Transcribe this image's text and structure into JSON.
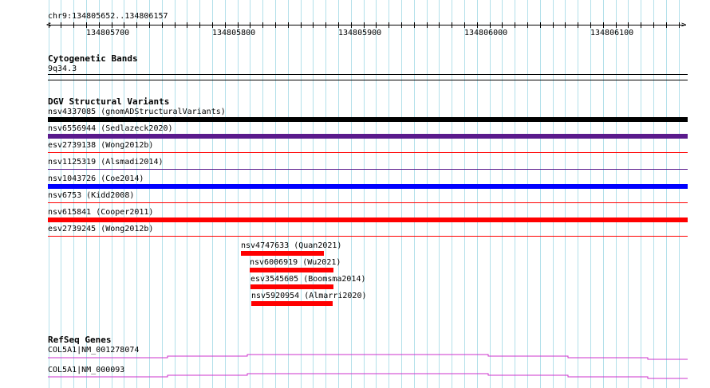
{
  "location": "chr9:134805652..134806157",
  "ruler": {
    "labels": [
      "134805700",
      "134805800",
      "134805900",
      "134806000",
      "134806100"
    ]
  },
  "tracks": {
    "cyto": {
      "title": "Cytogenetic Bands",
      "band": "9q34.3",
      "color": "#000000"
    },
    "dgv": {
      "title": "DGV Structural Variants",
      "items": [
        {
          "label": "nsv4337085 (gnomADStructuralVariants)",
          "color": "#000000"
        },
        {
          "label": "nsv6556944 (Sedlazeck2020)",
          "color": "#5a1a8c"
        },
        {
          "label": "esv2739138 (Wong2012b)",
          "color": "#ff0000"
        },
        {
          "label": "nsv1125319 (Alsmadi2014)",
          "color": "#ff0000"
        },
        {
          "label": "nsv1043726 (Coe2014)",
          "color": "#5a1a8c"
        },
        {
          "label": "nsv6753 (Kidd2008)",
          "color": "#0000ff"
        },
        {
          "label": "nsv615841 (Cooper2011)",
          "color": "#ff0000"
        },
        {
          "label": "esv2739245 (Wong2012b)",
          "color": "#ff0000"
        },
        {
          "label": "nsv4747633 (Quan2021)",
          "color": "#ff0000"
        },
        {
          "label": "nsv6006919 (Wu2021)",
          "color": "#ff0000"
        },
        {
          "label": "esv3545605 (Boomsma2014)",
          "color": "#ff0000"
        },
        {
          "label": "nsv5920954 (Almarri2020)",
          "color": "#ff0000"
        }
      ]
    },
    "refseq": {
      "title": "RefSeq Genes",
      "genes": [
        {
          "label": "COL5A1|NM_001278074",
          "color": "#cc33cc"
        },
        {
          "label": "COL5A1|NM_000093",
          "color": "#cc33cc"
        }
      ]
    }
  },
  "colors": {
    "grid": "#b3e0ea",
    "background": "#ffffff"
  }
}
